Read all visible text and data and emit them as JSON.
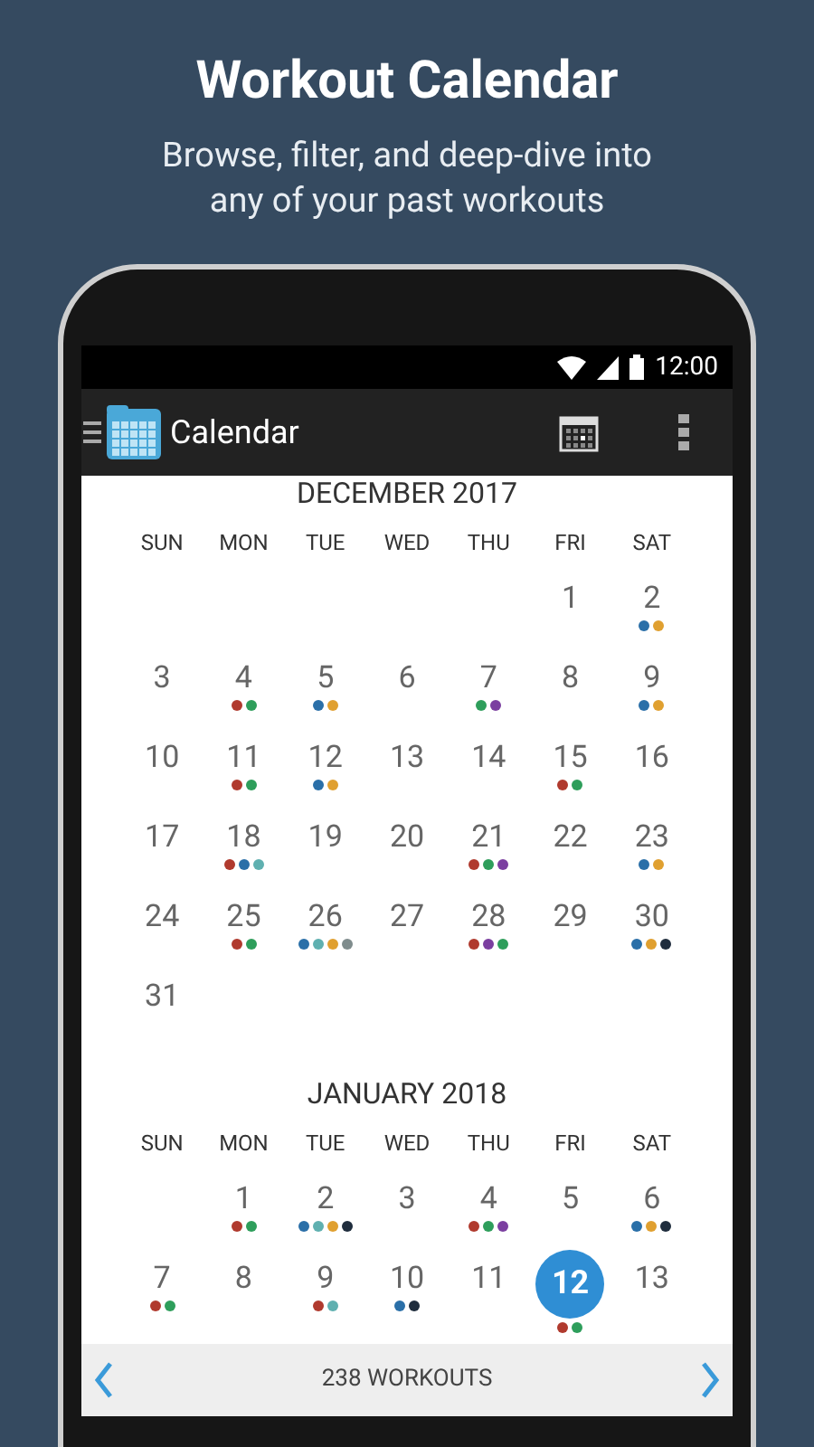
{
  "headline": "Workout Calendar",
  "subheadline": "Browse, filter, and deep-dive into any of your past workouts",
  "status_bar": {
    "time": "12:00"
  },
  "app_bar": {
    "title": "Calendar"
  },
  "months": [
    {
      "title": "DECEMBER 2017",
      "weekdays": [
        "SUN",
        "MON",
        "TUE",
        "WED",
        "THU",
        "FRI",
        "SAT"
      ],
      "weeks": [
        [
          {
            "kind": "empty"
          },
          {
            "kind": "empty"
          },
          {
            "kind": "empty"
          },
          {
            "kind": "empty"
          },
          {
            "kind": "empty"
          },
          {
            "kind": "day",
            "day": "1",
            "selected": false
          },
          {
            "kind": "day",
            "day": "2",
            "selected": false,
            "dots": [
              {
                "color": "#2a6fa8"
              },
              {
                "color": "#e0a030"
              }
            ]
          }
        ],
        [
          {
            "kind": "day",
            "day": "3",
            "selected": false
          },
          {
            "kind": "day",
            "day": "4",
            "selected": false,
            "dots": [
              {
                "color": "#b03a2e"
              },
              {
                "color": "#2e9e5b"
              }
            ]
          },
          {
            "kind": "day",
            "day": "5",
            "selected": false,
            "dots": [
              {
                "color": "#2a6fa8"
              },
              {
                "color": "#e0a030"
              }
            ]
          },
          {
            "kind": "day",
            "day": "6",
            "selected": false
          },
          {
            "kind": "day",
            "day": "7",
            "selected": false,
            "dots": [
              {
                "color": "#2e9e5b"
              },
              {
                "color": "#7b3fa0"
              }
            ]
          },
          {
            "kind": "day",
            "day": "8",
            "selected": false
          },
          {
            "kind": "day",
            "day": "9",
            "selected": false,
            "dots": [
              {
                "color": "#2a6fa8"
              },
              {
                "color": "#e0a030"
              }
            ]
          }
        ],
        [
          {
            "kind": "day",
            "day": "10",
            "selected": false
          },
          {
            "kind": "day",
            "day": "11",
            "selected": false,
            "dots": [
              {
                "color": "#b03a2e"
              },
              {
                "color": "#2e9e5b"
              }
            ]
          },
          {
            "kind": "day",
            "day": "12",
            "selected": false,
            "dots": [
              {
                "color": "#2a6fa8"
              },
              {
                "color": "#e0a030"
              }
            ]
          },
          {
            "kind": "day",
            "day": "13",
            "selected": false
          },
          {
            "kind": "day",
            "day": "14",
            "selected": false
          },
          {
            "kind": "day",
            "day": "15",
            "selected": false,
            "dots": [
              {
                "color": "#b03a2e"
              },
              {
                "color": "#2e9e5b"
              }
            ]
          },
          {
            "kind": "day",
            "day": "16",
            "selected": false
          }
        ],
        [
          {
            "kind": "day",
            "day": "17",
            "selected": false
          },
          {
            "kind": "day",
            "day": "18",
            "selected": false,
            "dots": [
              {
                "color": "#b03a2e"
              },
              {
                "color": "#2a6fa8"
              },
              {
                "color": "#5fb0b0"
              }
            ]
          },
          {
            "kind": "day",
            "day": "19",
            "selected": false
          },
          {
            "kind": "day",
            "day": "20",
            "selected": false
          },
          {
            "kind": "day",
            "day": "21",
            "selected": false,
            "dots": [
              {
                "color": "#b03a2e"
              },
              {
                "color": "#2e9e5b"
              },
              {
                "color": "#7b3fa0"
              }
            ]
          },
          {
            "kind": "day",
            "day": "22",
            "selected": false
          },
          {
            "kind": "day",
            "day": "23",
            "selected": false,
            "dots": [
              {
                "color": "#2a6fa8"
              },
              {
                "color": "#e0a030"
              }
            ]
          }
        ],
        [
          {
            "kind": "day",
            "day": "24",
            "selected": false
          },
          {
            "kind": "day",
            "day": "25",
            "selected": false,
            "dots": [
              {
                "color": "#b03a2e"
              },
              {
                "color": "#2e9e5b"
              }
            ]
          },
          {
            "kind": "day",
            "day": "26",
            "selected": false,
            "dots": [
              {
                "color": "#2a6fa8"
              },
              {
                "color": "#5fb0b0"
              },
              {
                "color": "#e0a030"
              },
              {
                "color": "#7f8c8d"
              }
            ]
          },
          {
            "kind": "day",
            "day": "27",
            "selected": false
          },
          {
            "kind": "day",
            "day": "28",
            "selected": false,
            "dots": [
              {
                "color": "#b03a2e"
              },
              {
                "color": "#7b3fa0"
              },
              {
                "color": "#2e9e5b"
              }
            ]
          },
          {
            "kind": "day",
            "day": "29",
            "selected": false
          },
          {
            "kind": "day",
            "day": "30",
            "selected": false,
            "dots": [
              {
                "color": "#2a6fa8"
              },
              {
                "color": "#e0a030"
              },
              {
                "color": "#1f2d3d"
              }
            ]
          }
        ],
        [
          {
            "kind": "day",
            "day": "31",
            "selected": false
          }
        ]
      ]
    },
    {
      "title": "JANUARY 2018",
      "weekdays": [
        "SUN",
        "MON",
        "TUE",
        "WED",
        "THU",
        "FRI",
        "SAT"
      ],
      "weeks": [
        [
          {
            "kind": "empty"
          },
          {
            "kind": "day",
            "day": "1",
            "selected": false,
            "dots": [
              {
                "color": "#b03a2e"
              },
              {
                "color": "#2e9e5b"
              }
            ]
          },
          {
            "kind": "day",
            "day": "2",
            "selected": false,
            "dots": [
              {
                "color": "#2a6fa8"
              },
              {
                "color": "#5fb0b0"
              },
              {
                "color": "#e0a030"
              },
              {
                "color": "#1f2d3d"
              }
            ]
          },
          {
            "kind": "day",
            "day": "3",
            "selected": false
          },
          {
            "kind": "day",
            "day": "4",
            "selected": false,
            "dots": [
              {
                "color": "#b03a2e"
              },
              {
                "color": "#2e9e5b"
              },
              {
                "color": "#7b3fa0"
              }
            ]
          },
          {
            "kind": "day",
            "day": "5",
            "selected": false
          },
          {
            "kind": "day",
            "day": "6",
            "selected": false,
            "dots": [
              {
                "color": "#2a6fa8"
              },
              {
                "color": "#e0a030"
              },
              {
                "color": "#1f2d3d"
              }
            ]
          }
        ],
        [
          {
            "kind": "day",
            "day": "7",
            "selected": false,
            "dots": [
              {
                "color": "#b03a2e"
              },
              {
                "color": "#2e9e5b"
              }
            ]
          },
          {
            "kind": "day",
            "day": "8",
            "selected": false
          },
          {
            "kind": "day",
            "day": "9",
            "selected": false,
            "dots": [
              {
                "color": "#b03a2e"
              },
              {
                "color": "#5fb0b0"
              }
            ]
          },
          {
            "kind": "day",
            "day": "10",
            "selected": false,
            "dots": [
              {
                "color": "#2a6fa8"
              },
              {
                "color": "#1f2d3d"
              }
            ]
          },
          {
            "kind": "day",
            "day": "11",
            "selected": false
          },
          {
            "kind": "day",
            "day": "12",
            "selected": true,
            "dots": [
              {
                "color": "#b03a2e"
              },
              {
                "color": "#2e9e5b"
              }
            ]
          },
          {
            "kind": "day",
            "day": "13",
            "selected": false
          }
        ]
      ]
    }
  ],
  "footer": {
    "label": "238 WORKOUTS"
  }
}
